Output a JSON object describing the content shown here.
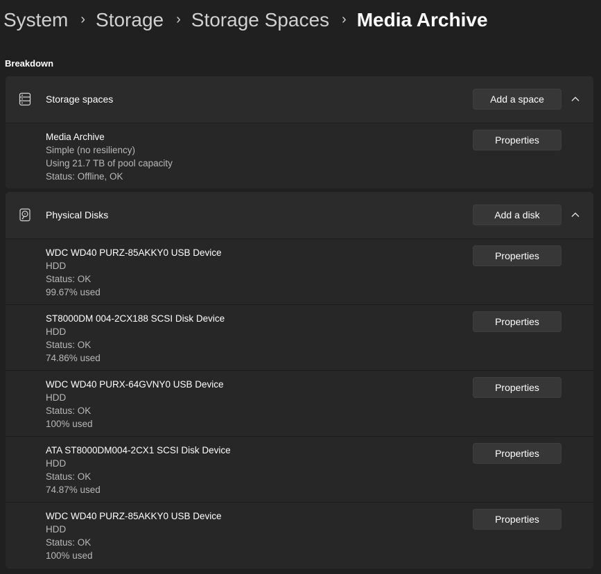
{
  "breadcrumb": {
    "items": [
      "System",
      "Storage",
      "Storage Spaces"
    ],
    "current": "Media Archive",
    "separator": "›"
  },
  "section_title": "Breakdown",
  "storage_spaces": {
    "title": "Storage spaces",
    "icon": "storage-stack-icon",
    "add_label": "Add a space",
    "items": [
      {
        "name": "Media Archive",
        "resiliency": "Simple (no resiliency)",
        "usage": "Using 21.7 TB of pool capacity",
        "status": "Status: Offline, OK",
        "button": "Properties"
      }
    ]
  },
  "physical_disks": {
    "title": "Physical Disks",
    "icon": "hard-drive-icon",
    "add_label": "Add a disk",
    "items": [
      {
        "name": "WDC WD40 PURZ-85AKKY0 USB Device",
        "type": "HDD",
        "status": "Status: OK",
        "used": "99.67% used",
        "button": "Properties"
      },
      {
        "name": "ST8000DM 004-2CX188 SCSI Disk Device",
        "type": "HDD",
        "status": "Status: OK",
        "used": "74.86% used",
        "button": "Properties"
      },
      {
        "name": "WDC WD40 PURX-64GVNY0 USB Device",
        "type": "HDD",
        "status": "Status: OK",
        "used": "100% used",
        "button": "Properties"
      },
      {
        "name": "ATA ST8000DM004-2CX1 SCSI Disk Device",
        "type": "HDD",
        "status": "Status: OK",
        "used": "74.87% used",
        "button": "Properties"
      },
      {
        "name": "WDC WD40 PURZ-85AKKY0 USB Device",
        "type": "HDD",
        "status": "Status: OK",
        "used": "100% used",
        "button": "Properties"
      }
    ]
  },
  "colors": {
    "background": "#202020",
    "panel": "#2b2b2b",
    "row": "#272727",
    "button": "#373737",
    "text_secondary": "#b8b8b8"
  }
}
